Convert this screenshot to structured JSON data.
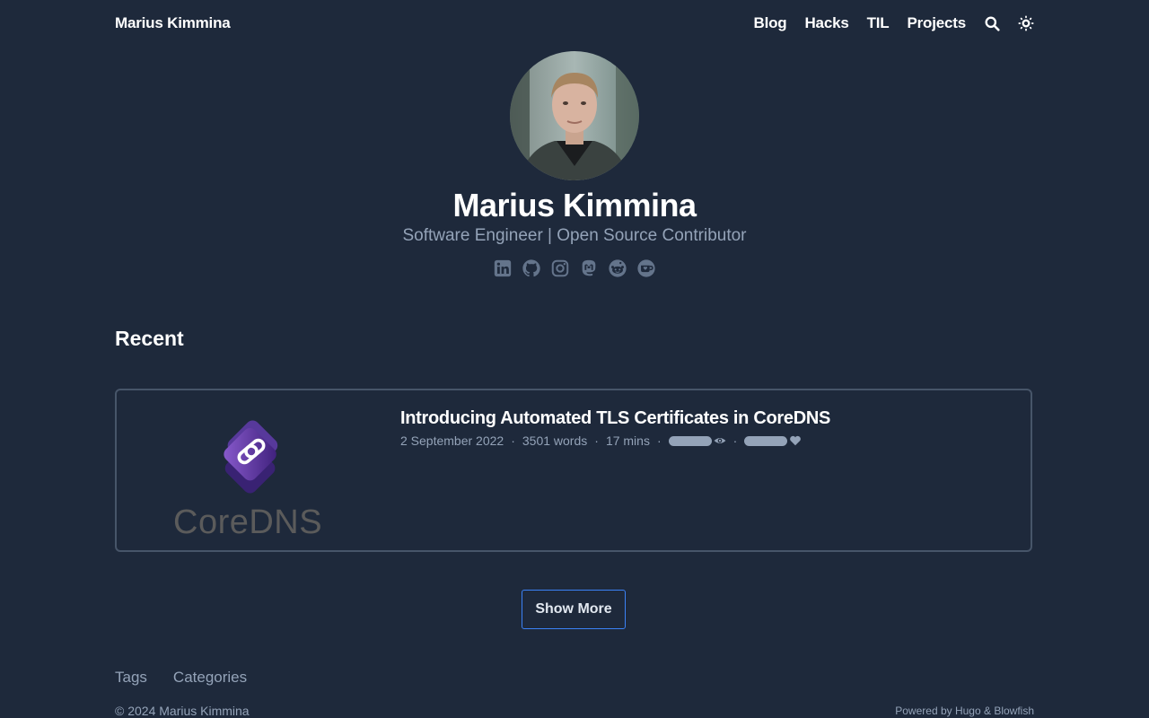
{
  "header": {
    "site_title": "Marius Kimmina",
    "nav": [
      "Blog",
      "Hacks",
      "TIL",
      "Projects"
    ],
    "icons": [
      "search-icon",
      "theme-toggle-icon"
    ]
  },
  "profile": {
    "name": "Marius Kimmina",
    "tagline": "Software Engineer | Open Source Contributor",
    "socials": [
      "linkedin-icon",
      "github-icon",
      "instagram-icon",
      "mastodon-icon",
      "reddit-icon",
      "kofi-icon"
    ]
  },
  "recent": {
    "heading": "Recent",
    "articles": [
      {
        "title": "Introducing Automated TLS Certificates in CoreDNS",
        "date": "2 September 2022",
        "words": "3501 words",
        "duration": "17 mins",
        "thumbnail_text": "CoreDNS"
      }
    ],
    "show_more": "Show More"
  },
  "footer": {
    "links": [
      "Tags",
      "Categories"
    ],
    "copyright": "© 2024 Marius Kimmina",
    "powered": "Powered by Hugo & Blowfish"
  },
  "colors": {
    "background": "#1e293b",
    "muted": "#94a3b8",
    "accent": "#3b82f6",
    "card_border": "#475569"
  }
}
